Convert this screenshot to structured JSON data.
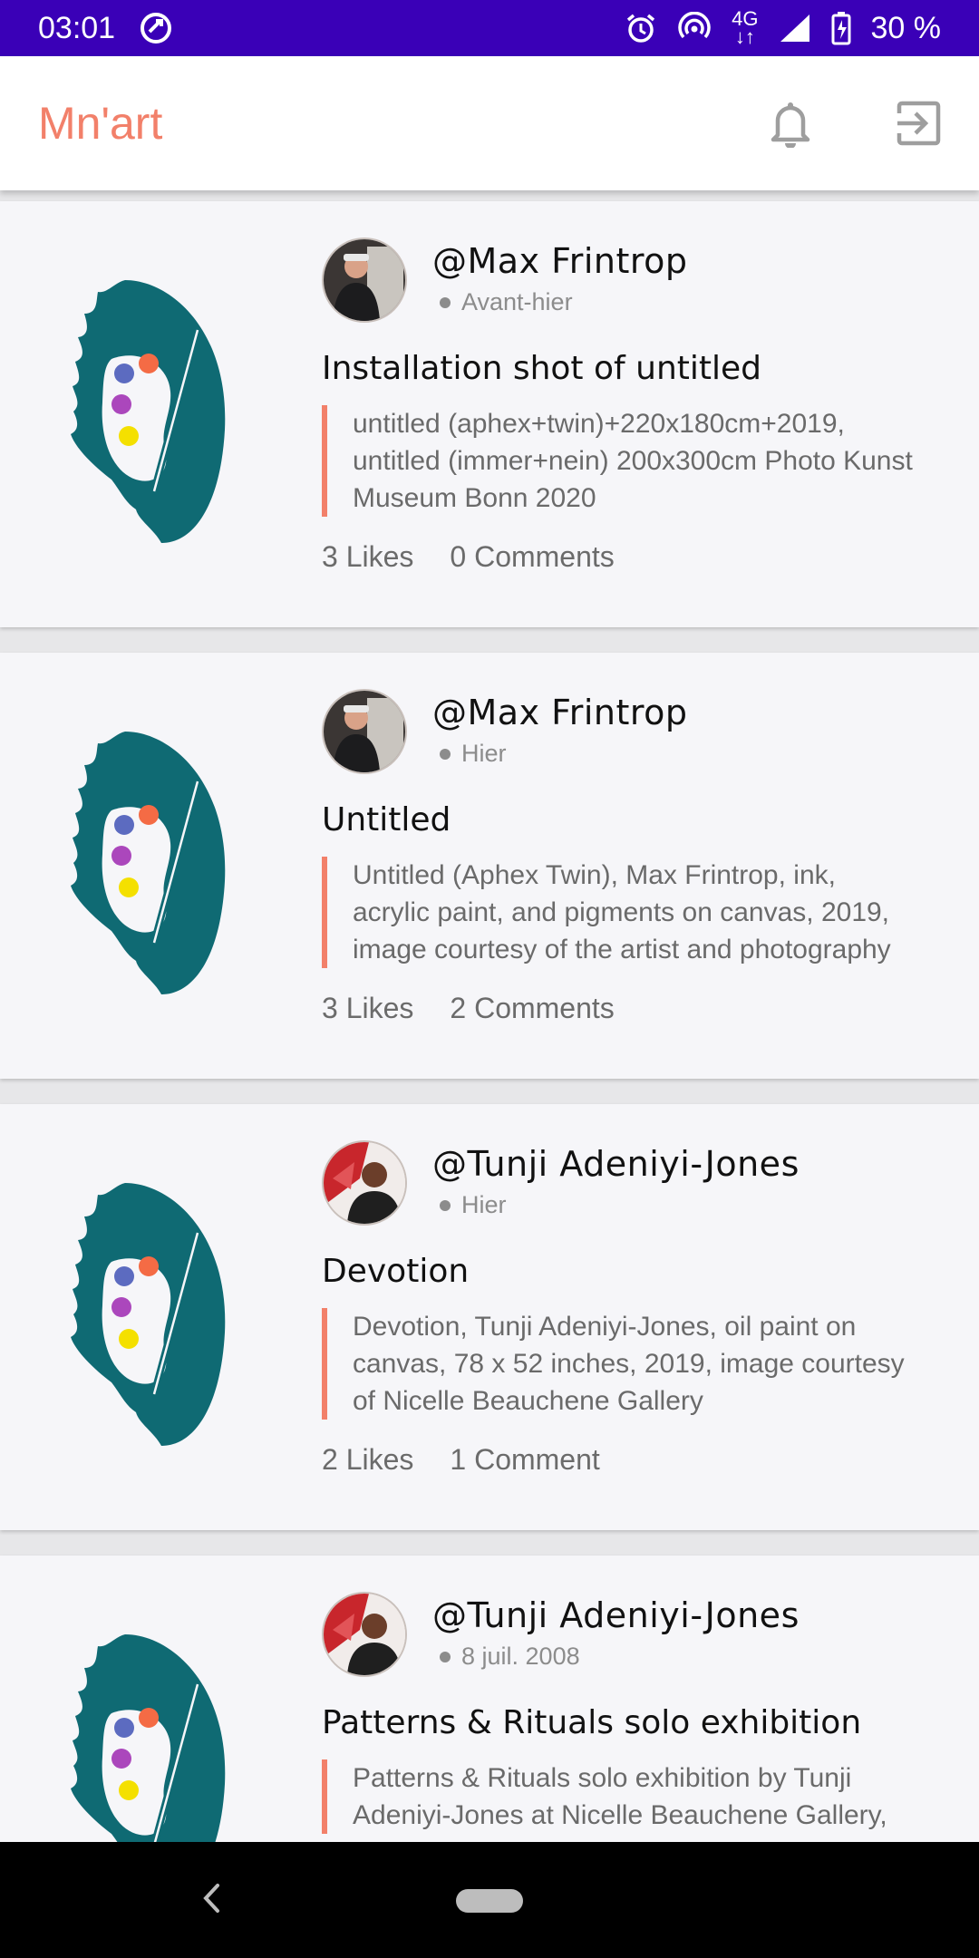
{
  "status_bar": {
    "time": "03:01",
    "network": "4G",
    "battery": "30 %"
  },
  "app_bar": {
    "title": "Mn'art",
    "icons": [
      "bell-icon",
      "logout-icon"
    ]
  },
  "colors": {
    "accent": "#f2806a",
    "status_bar": "#3a00b7",
    "logo_teal": "#0f6a73",
    "card_bg": "#f6f6f9"
  },
  "posts": [
    {
      "author": "@Max Frintrop",
      "date": "Avant-hier",
      "title": "Installation shot of untitled",
      "description": "untitled (aphex+twin)+220x180cm+2019, untitled (immer+nein) 200x300cm Photo Kunst Museum Bonn 2020",
      "likes": "3 Likes",
      "comments": "0 Comments",
      "avatar": "max"
    },
    {
      "author": "@Max Frintrop",
      "date": "Hier",
      "title": "Untitled",
      "description": "Untitled (Aphex Twin), Max Frintrop, ink, acrylic paint, and pigments on canvas, 2019, image courtesy of the artist and photography",
      "likes": "3 Likes",
      "comments": "2 Comments",
      "avatar": "max"
    },
    {
      "author": "@Tunji Adeniyi-Jones",
      "date": "Hier",
      "title": "Devotion",
      "description": "Devotion, Tunji Adeniyi-Jones, oil paint on canvas, 78 x 52 inches, 2019, image courtesy of Nicelle Beauchene Gallery",
      "likes": "2 Likes",
      "comments": "1 Comment",
      "avatar": "tunji"
    },
    {
      "author": "@Tunji Adeniyi-Jones",
      "date": "8 juil. 2008",
      "title": "Patterns & Rituals solo exhibition",
      "description": "Patterns & Rituals solo exhibition by Tunji Adeniyi-Jones at Nicelle Beauchene Gallery,",
      "likes": "",
      "comments": "",
      "avatar": "tunji"
    }
  ]
}
